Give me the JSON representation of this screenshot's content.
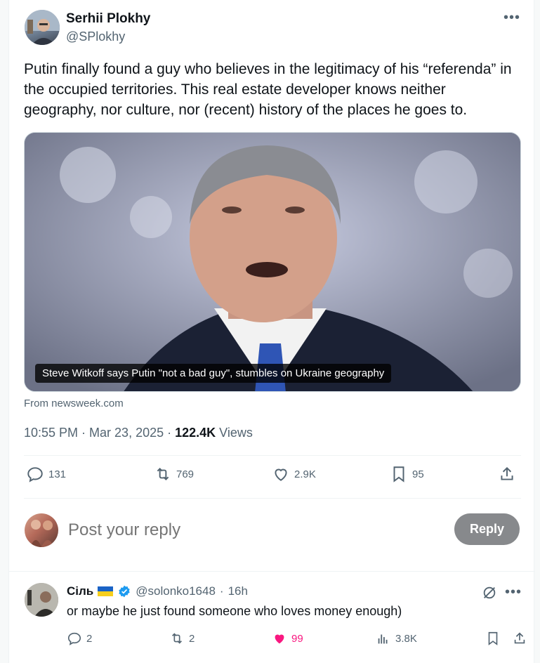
{
  "author": {
    "name": "Serhii Plokhy",
    "handle": "@SPlokhy"
  },
  "tweet": {
    "text": "Putin finally found a guy who believes in the legitimacy of his “referenda” in the occupied territories. This real estate developer knows neither geography, nor culture, nor (recent) history of the places he goes to."
  },
  "media": {
    "caption": "Steve Witkoff says Putin \"not a bad guy\", stumbles on Ukraine geography",
    "source": "From newsweek.com"
  },
  "meta": {
    "time": "10:55 PM · Mar 23, 2025 · ",
    "views_count": "122.4K",
    "views_label": " Views"
  },
  "actions": {
    "replies": "131",
    "reposts": "769",
    "likes": "2.9K",
    "bookmarks": "95"
  },
  "composer": {
    "placeholder": "Post your reply",
    "button": "Reply"
  },
  "comment": {
    "name": "Сіль",
    "handle": "@solonko1648",
    "separator": "·",
    "time": "16h",
    "text": "or maybe he just found someone who loves money enough)",
    "replies": "2",
    "reposts": "2",
    "likes": "99",
    "views": "3.8K"
  },
  "colors": {
    "like_active": "#f91880",
    "verified": "#1d9bf0",
    "muted": "#536471"
  },
  "icons": [
    "reply-icon",
    "repost-icon",
    "like-icon",
    "bookmark-icon",
    "share-icon",
    "more-icon",
    "verified-icon",
    "ukraine-flag-icon",
    "grok-icon",
    "views-icon"
  ]
}
